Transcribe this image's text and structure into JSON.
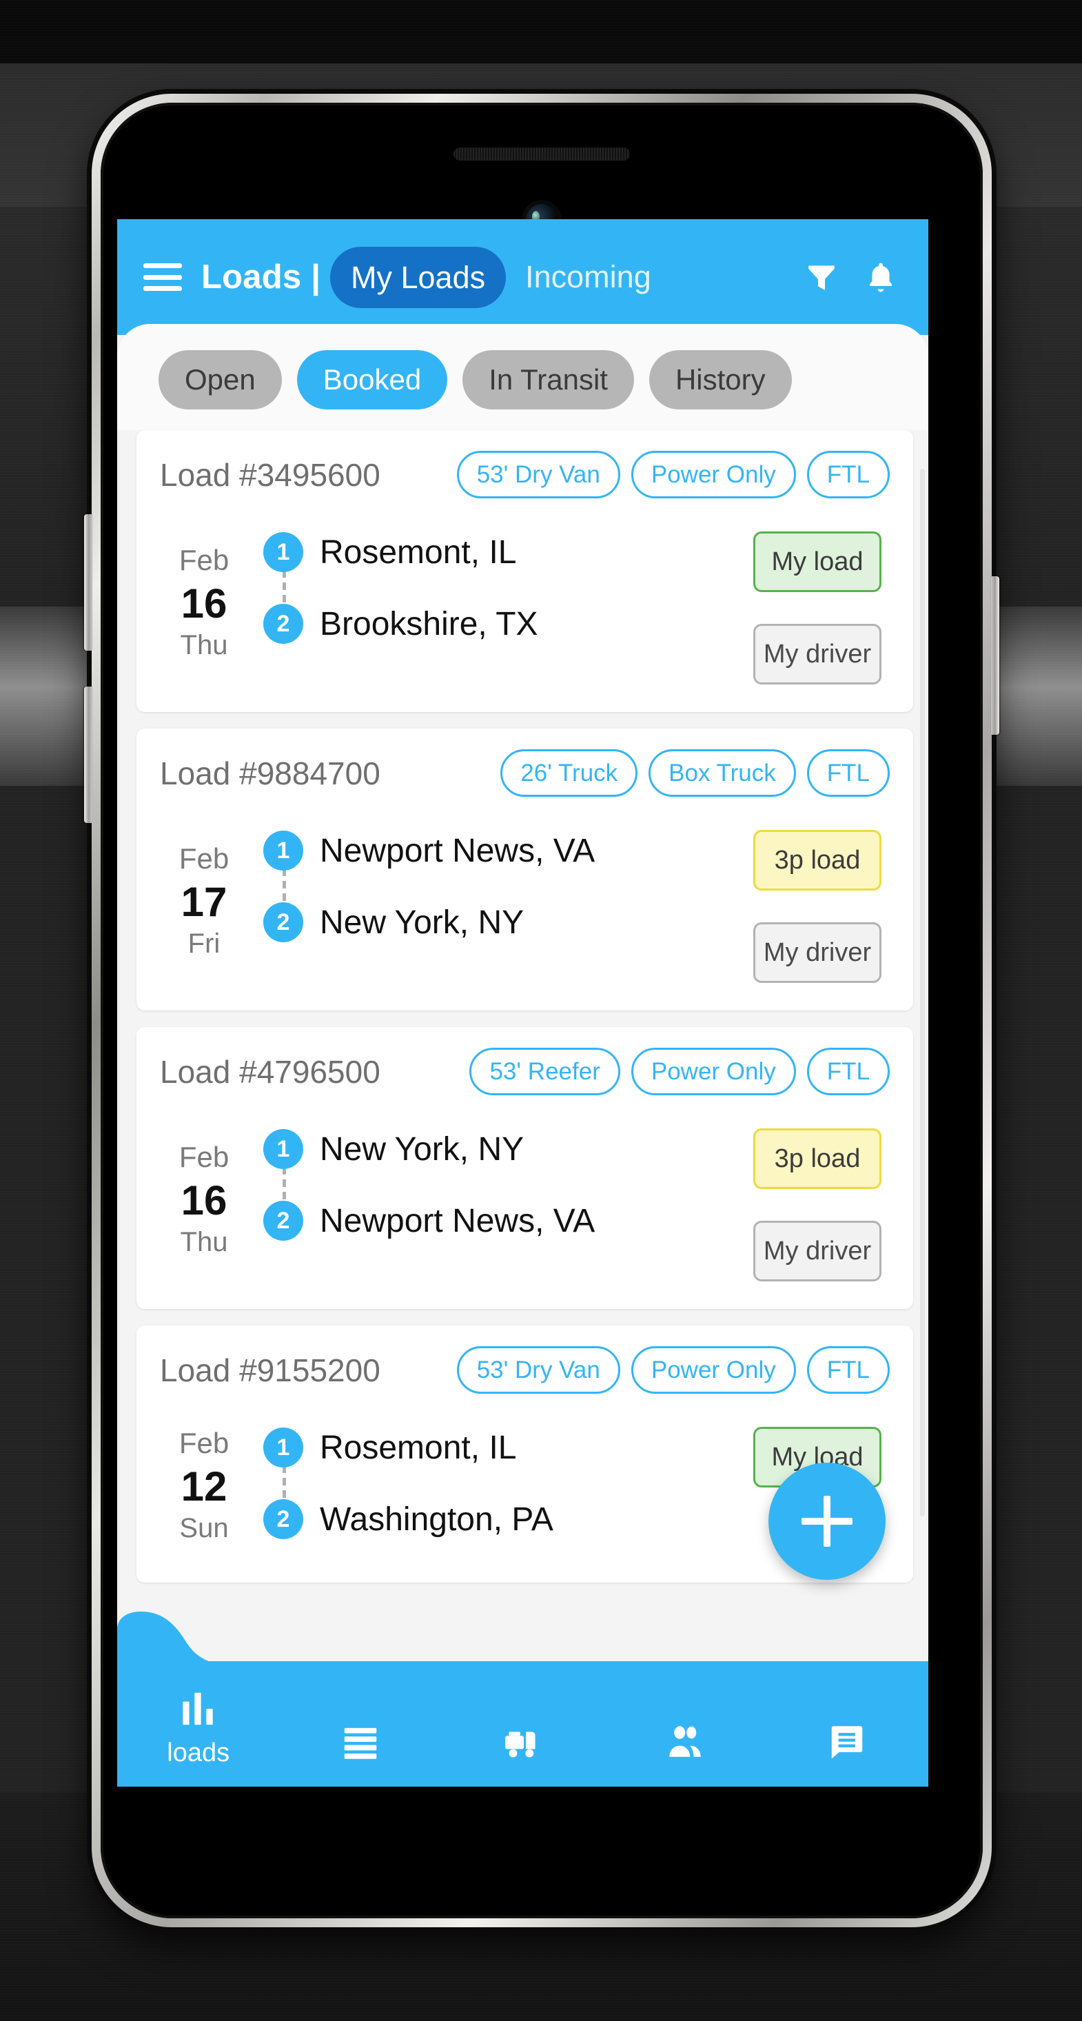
{
  "theme": {
    "accent": "#33b5f5",
    "accent_dark": "#1471c6",
    "chip_inactive": "#b6b6b6",
    "green_badge_bg": "#dff2dc",
    "green_badge_border": "#56b24d",
    "yellow_badge_bg": "#fcf6c2",
    "yellow_badge_border": "#ecdc3f",
    "grey_badge_bg": "#f2f2f2",
    "grey_badge_border": "#b3b3b3"
  },
  "appbar": {
    "menu_icon": "hamburger-menu-icon",
    "title": "Loads",
    "separator": "|",
    "active_tab": "My Loads",
    "inactive_tab": "Incoming",
    "filter_icon": "filter-funnel-icon",
    "bell_icon": "notification-bell-icon"
  },
  "chips": [
    {
      "label": "Open",
      "active": false
    },
    {
      "label": "Booked",
      "active": true
    },
    {
      "label": "In Transit",
      "active": false
    },
    {
      "label": "History",
      "active": false
    }
  ],
  "cards": [
    {
      "load_id": "Load #3495600",
      "tags": [
        "53' Dry Van",
        "Power Only",
        "FTL"
      ],
      "date": {
        "month": "Feb",
        "day": "16",
        "weekday": "Thu"
      },
      "stops": [
        {
          "num": "1",
          "name": "Rosemont, IL"
        },
        {
          "num": "2",
          "name": "Brookshire, TX"
        }
      ],
      "badges": [
        {
          "label": "My load",
          "style": "green"
        },
        {
          "label": "My driver",
          "style": "grey"
        }
      ]
    },
    {
      "load_id": "Load #9884700",
      "tags": [
        "26' Truck",
        "Box Truck",
        "FTL"
      ],
      "date": {
        "month": "Feb",
        "day": "17",
        "weekday": "Fri"
      },
      "stops": [
        {
          "num": "1",
          "name": "Newport News, VA"
        },
        {
          "num": "2",
          "name": "New York, NY"
        }
      ],
      "badges": [
        {
          "label": "3p load",
          "style": "yellow"
        },
        {
          "label": "My driver",
          "style": "grey"
        }
      ]
    },
    {
      "load_id": "Load #4796500",
      "tags": [
        "53' Reefer",
        "Power Only",
        "FTL"
      ],
      "date": {
        "month": "Feb",
        "day": "16",
        "weekday": "Thu"
      },
      "stops": [
        {
          "num": "1",
          "name": "New York, NY"
        },
        {
          "num": "2",
          "name": "Newport News, VA"
        }
      ],
      "badges": [
        {
          "label": "3p load",
          "style": "yellow"
        },
        {
          "label": "My driver",
          "style": "grey"
        }
      ]
    },
    {
      "load_id": "Load #9155200",
      "tags": [
        "53' Dry Van",
        "Power Only",
        "FTL"
      ],
      "date": {
        "month": "Feb",
        "day": "12",
        "weekday": "Sun"
      },
      "stops": [
        {
          "num": "1",
          "name": "Rosemont, IL"
        },
        {
          "num": "2",
          "name": "Washington, PA"
        }
      ],
      "badges": [
        {
          "label": "My load",
          "style": "green"
        }
      ]
    }
  ],
  "fab": {
    "icon": "plus-icon",
    "label": "+"
  },
  "bottom_nav": [
    {
      "icon": "bar-chart-icon",
      "label": "loads",
      "active": true
    },
    {
      "icon": "list-lines-icon",
      "label": "",
      "active": false
    },
    {
      "icon": "truck-icon",
      "label": "",
      "active": false
    },
    {
      "icon": "people-icon",
      "label": "",
      "active": false
    },
    {
      "icon": "chat-message-icon",
      "label": "",
      "active": false
    }
  ]
}
